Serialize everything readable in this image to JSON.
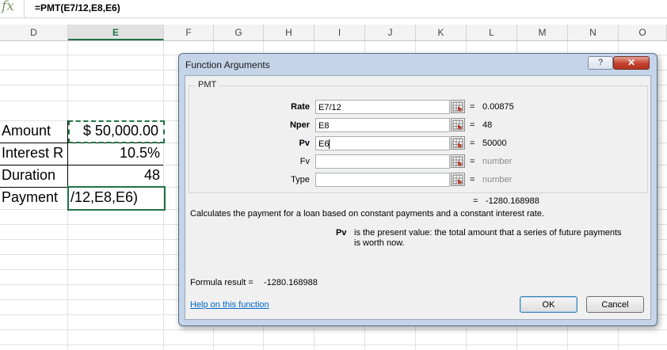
{
  "formula_bar": {
    "fx_icon": "fx",
    "formula": "=PMT(E7/12,E8,E6)"
  },
  "columns": [
    "D",
    "E",
    "F",
    "G",
    "H",
    "I",
    "J",
    "K",
    "L",
    "M",
    "N",
    "O"
  ],
  "selected_column": "E",
  "cells": {
    "amount_label": "Amount",
    "amount_value": "$ 50,000.00",
    "rate_label": "Interest R",
    "rate_value": "10.5%",
    "duration_label": "Duration",
    "duration_value": "48",
    "payment_label": "Payment",
    "payment_value": "/12,E8,E6)"
  },
  "dialog": {
    "title": "Function Arguments",
    "help_button": "?",
    "close_button": "✕",
    "function_name": "PMT",
    "arguments": [
      {
        "name": "Rate",
        "bold": true,
        "input": "E7/12",
        "value": "0.00875"
      },
      {
        "name": "Nper",
        "bold": true,
        "input": "E8",
        "value": "48"
      },
      {
        "name": "Pv",
        "bold": true,
        "input": "E6",
        "value": "50000"
      },
      {
        "name": "Fv",
        "bold": false,
        "input": "",
        "value": "number"
      },
      {
        "name": "Type",
        "bold": false,
        "input": "",
        "value": "number"
      }
    ],
    "equals": "=",
    "result_value": "-1280.168988",
    "description": "Calculates the payment for a loan based on constant payments and a constant interest rate.",
    "arg_help_name": "Pv",
    "arg_help_line1": "is the present value: the total amount that a series of future payments",
    "arg_help_line2": "is worth now.",
    "formula_result_label": "Formula result =",
    "formula_result_value": "-1280.168988",
    "help_link": "Help on this function",
    "ok_label": "OK",
    "cancel_label": "Cancel"
  }
}
